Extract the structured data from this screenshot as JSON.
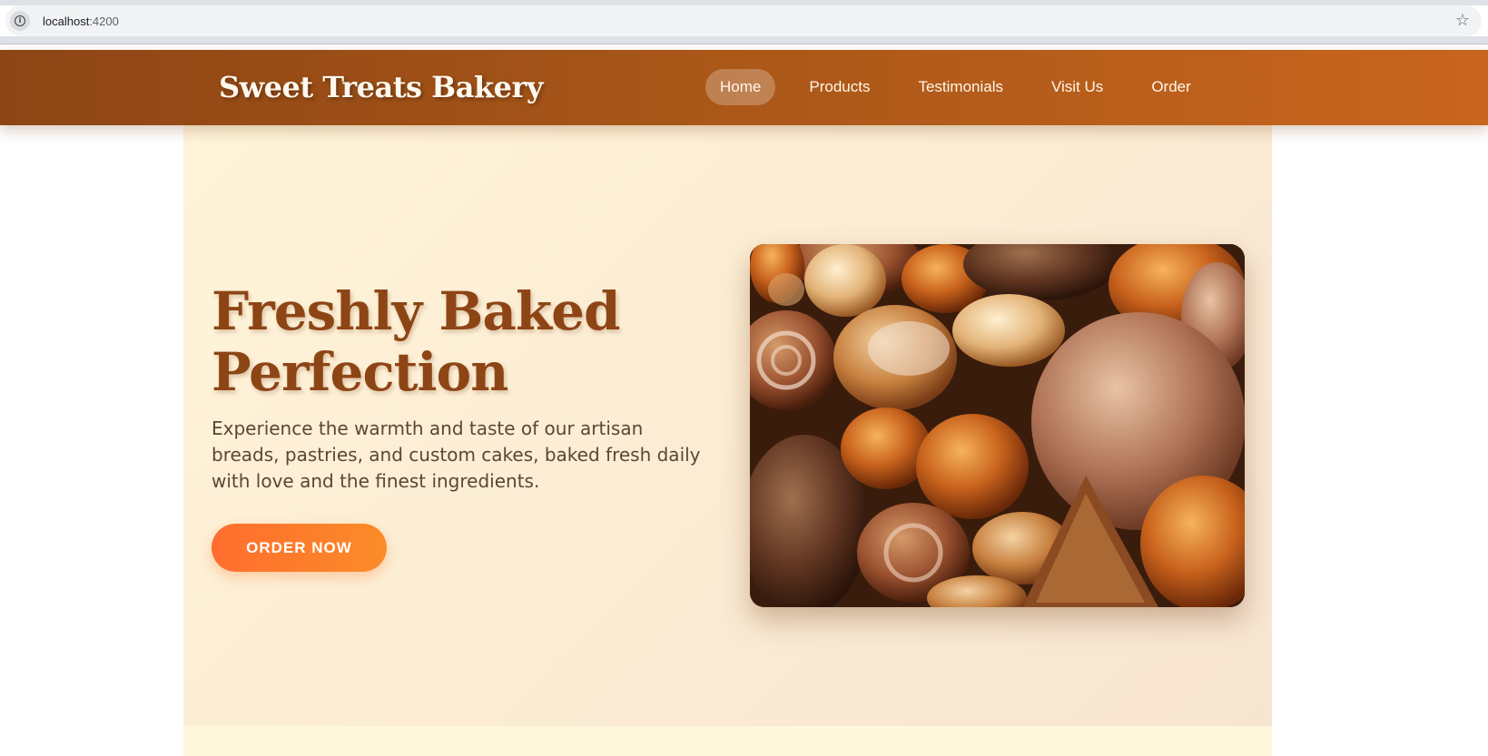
{
  "browser": {
    "url_host": "localhost",
    "url_port": ":4200",
    "icons": [
      "site-info-icon",
      "bookmark-star-icon"
    ]
  },
  "navbar": {
    "brand": "Sweet Treats Bakery",
    "items": [
      {
        "label": "Home",
        "active": true
      },
      {
        "label": "Products",
        "active": false
      },
      {
        "label": "Testimonials",
        "active": false
      },
      {
        "label": "Visit Us",
        "active": false
      },
      {
        "label": "Order",
        "active": false
      }
    ]
  },
  "hero": {
    "title_line1": "Freshly Baked",
    "title_line2": "Perfection",
    "description": "Experience the warmth and taste of our artisan breads, pastries, and custom cakes, baked fresh daily with love and the finest ingredients.",
    "cta_label": "ORDER NOW",
    "image_alt": "Assorted breads and pastries"
  },
  "colors": {
    "navbar_start": "#8d4515",
    "navbar_end": "#c8651e",
    "title": "#8e4516",
    "cta_start": "#ff6d2e",
    "cta_end": "#fb8c28",
    "hero_bg": "#fff4d9"
  }
}
